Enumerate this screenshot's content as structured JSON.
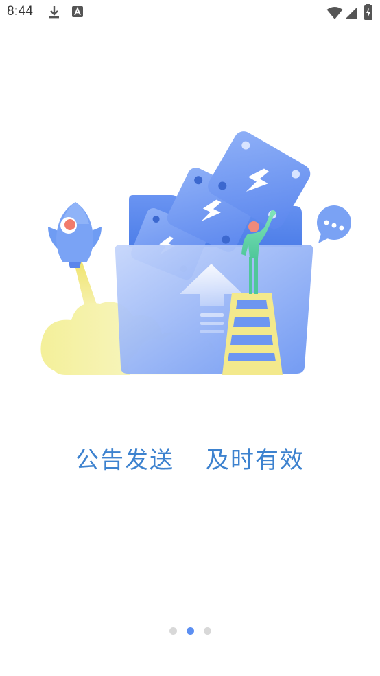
{
  "status_bar": {
    "time": "8:44",
    "icons": [
      "download-icon",
      "a-notification-icon",
      "wifi-icon",
      "cellular-signal-icon",
      "battery-charging-icon"
    ]
  },
  "onboarding": {
    "illustration": "folder-with-cards-rocket-person-ladder",
    "slogan_part1": "公告发送",
    "slogan_part2": "及时有效",
    "page_count": 3,
    "current_page": 2
  },
  "colors": {
    "accent": "#3d82cf",
    "dot_active": "#5c8ff2",
    "dot_inactive": "#d8d8d8"
  }
}
